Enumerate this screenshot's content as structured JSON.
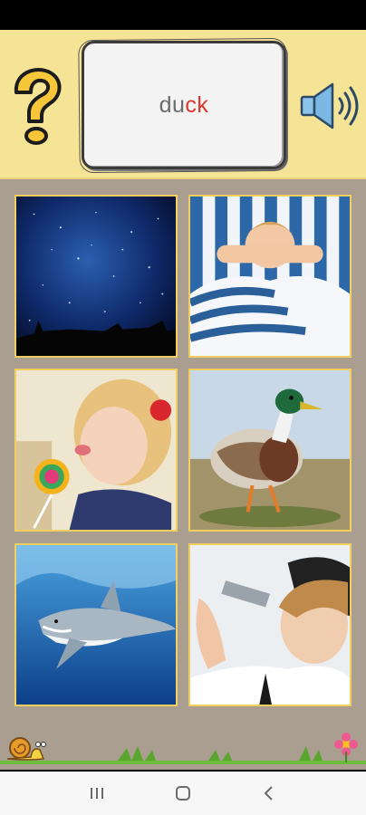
{
  "word": {
    "plain": "du",
    "highlight": "ck"
  },
  "icons": {
    "help": "question-mark-icon",
    "sound": "speaker-icon"
  },
  "accent_colors": {
    "panel": "#f6e496",
    "highlight_letters": "#d9382e",
    "tile_border": "#f2cf5e",
    "background": "#a99e8f"
  },
  "tiles": [
    {
      "subject": "night-sky"
    },
    {
      "subject": "boy-waking-up"
    },
    {
      "subject": "girl-lollipop"
    },
    {
      "subject": "duck"
    },
    {
      "subject": "shark"
    },
    {
      "subject": "bartender"
    }
  ],
  "nav": [
    "recent-apps",
    "home",
    "back"
  ]
}
